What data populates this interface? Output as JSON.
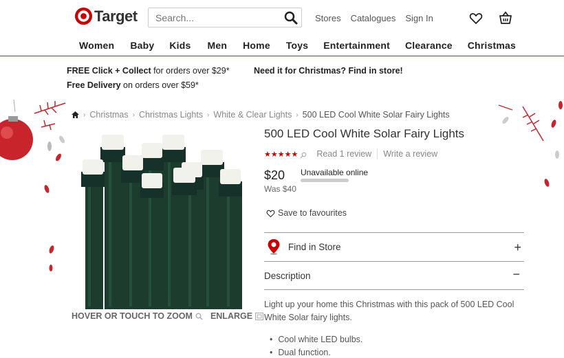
{
  "header": {
    "logo_text": "Target",
    "search_placeholder": "Search...",
    "links": [
      "Stores",
      "Catalogues",
      "Sign In"
    ],
    "nav": [
      "Women",
      "Baby",
      "Kids",
      "Men",
      "Home",
      "Toys",
      "Entertainment",
      "Clearance",
      "Christmas"
    ]
  },
  "promo": {
    "click_collect_bold": "FREE Click + Collect",
    "click_collect_rest": " for orders over $29*",
    "delivery_bold": "Free Delivery",
    "delivery_rest": " on orders over $59*",
    "christmas_msg": "Need it for Christmas? Find in store!"
  },
  "breadcrumb": [
    "Christmas",
    "Christmas Lights",
    "White & Clear Lights",
    "500 LED Cool White Solar Fairy Lights"
  ],
  "product": {
    "title": "500 LED Cool White Solar Fairy Lights",
    "stars": "★★★★★",
    "rating": 5,
    "read_reviews": "Read 1 review",
    "write_review": "Write a review",
    "price": "$20",
    "was_price": "Was $40",
    "availability": "Unavailable online",
    "save_label": "Save to favourites",
    "zoom_label": "HOVER OR TOUCH TO ZOOM",
    "enlarge_label": "ENLARGE",
    "find_in_store": "Find in Store",
    "description_label": "Description",
    "description": "Light up your home this Christmas with this pack of 500 LED Cool White Solar fairy lights.",
    "features": [
      "Cool white LED bulbs.",
      "Dual function."
    ]
  },
  "colors": {
    "brand_red": "#cc0000",
    "divider": "#b3282d"
  }
}
